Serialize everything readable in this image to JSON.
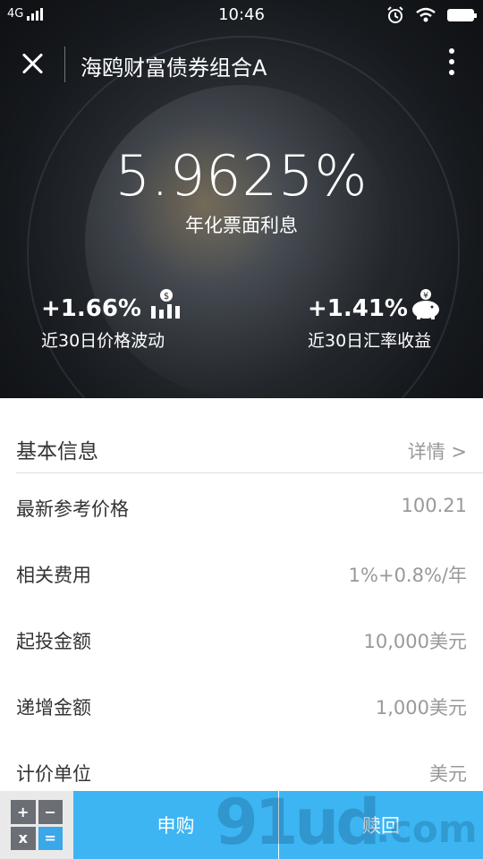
{
  "status": {
    "network": "4G",
    "time": "10:46"
  },
  "nav": {
    "title": "海鸥财富债券组合A"
  },
  "hero": {
    "rate": "5.9625%",
    "rate_label": "年化票面利息",
    "left_stat": {
      "value": "+1.66%",
      "label": "近30日价格波动",
      "icon": "chart-icon"
    },
    "right_stat": {
      "value": "+1.41%",
      "label": "近30日汇率收益",
      "icon": "piggy-bank-icon"
    }
  },
  "basic_info": {
    "title": "基本信息",
    "details_link": "详情 >"
  },
  "rows": [
    {
      "label": "最新参考价格",
      "value": "100.21"
    },
    {
      "label": "相关费用",
      "value": "1%+0.8%/年"
    },
    {
      "label": "起投金额",
      "value": "10,000美元"
    },
    {
      "label": "递增金额",
      "value": "1,000美元"
    },
    {
      "label": "计价单位",
      "value": "美元"
    }
  ],
  "bottom": {
    "calc_keys": [
      "+",
      "−",
      "x",
      "="
    ],
    "buy_label": "申购",
    "redeem_label": "赎回",
    "watermark": "91ud",
    "watermark2": ".com"
  },
  "colors": {
    "accent": "#3db5f3",
    "dark_bg": "#16191d"
  }
}
